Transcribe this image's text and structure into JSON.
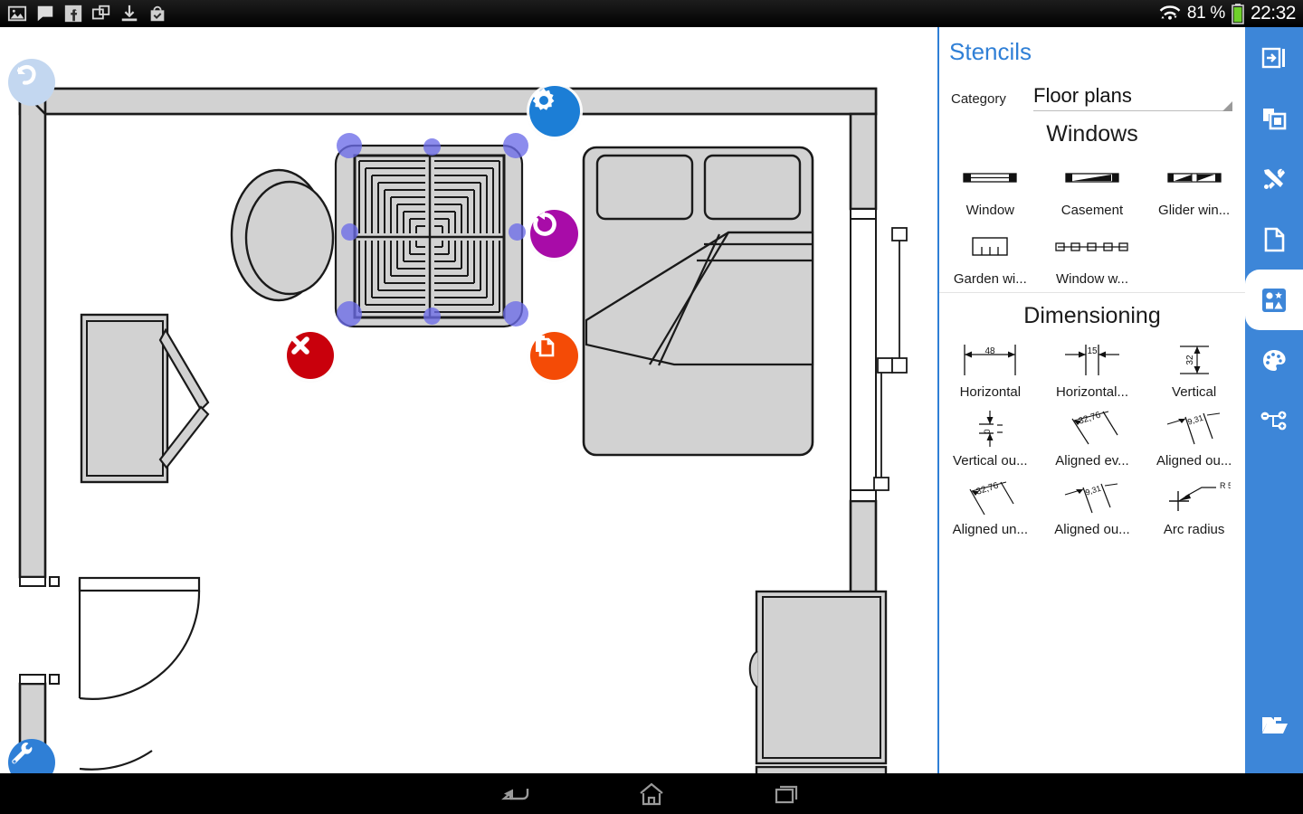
{
  "statusbar": {
    "notification_icons": [
      "image-icon",
      "message-icon",
      "facebook-icon",
      "screenshot-icon",
      "download-icon",
      "shopping-bag-check-icon"
    ],
    "wifi_icon": "wifi-icon",
    "battery_percent": "81 %",
    "battery_icon": "battery-icon",
    "clock": "22:32"
  },
  "canvas": {
    "name": "floor-plan-canvas",
    "undo_icon": "undo-icon",
    "tools_icon": "wrench-icon",
    "selection": {
      "object": "parquet-tile-pattern",
      "settings_icon": "gear-icon",
      "rotate_icon": "rotate-icon",
      "delete_icon": "delete-x-icon",
      "duplicate_icon": "copy-icon"
    },
    "objects": [
      "room-walls",
      "armchair",
      "desk-with-arms",
      "double-bed",
      "sliding-window-right-wall",
      "door-with-swing-arc",
      "wardrobe-cabinet",
      "parquet-rug"
    ]
  },
  "stencils": {
    "title": "Stencils",
    "category_label": "Category",
    "category_value": "Floor plans",
    "category_options": [
      "Floor plans"
    ],
    "groups": [
      {
        "title": "Windows",
        "items": [
          {
            "caption": "Window",
            "icon": "window-stencil-icon"
          },
          {
            "caption": "Casement",
            "icon": "casement-window-stencil-icon"
          },
          {
            "caption": "Glider win...",
            "icon": "glider-window-stencil-icon"
          },
          {
            "caption": "Garden wi...",
            "icon": "garden-window-stencil-icon"
          },
          {
            "caption": "Window w...",
            "icon": "window-wall-stencil-icon"
          }
        ]
      },
      {
        "title": "Dimensioning",
        "items": [
          {
            "caption": "Horizontal",
            "icon": "horizontal-dimension-icon",
            "value": "48"
          },
          {
            "caption": "Horizontal...",
            "icon": "horizontal-outside-dimension-icon",
            "value": "15"
          },
          {
            "caption": "Vertical",
            "icon": "vertical-dimension-icon",
            "value": "32"
          },
          {
            "caption": "Vertical ou...",
            "icon": "vertical-outside-dimension-icon",
            "value": "0"
          },
          {
            "caption": "Aligned ev...",
            "icon": "aligned-even-dimension-icon",
            "value": "32,76"
          },
          {
            "caption": "Aligned ou...",
            "icon": "aligned-outside-dimension-icon",
            "value": "9,31"
          },
          {
            "caption": "Aligned un...",
            "icon": "aligned-under-dimension-icon",
            "value": "32,76"
          },
          {
            "caption": "Aligned ou...",
            "icon": "aligned-outside2-dimension-icon",
            "value": "9,31"
          },
          {
            "caption": "Arc radius",
            "icon": "arc-radius-dimension-icon",
            "value": "R 5"
          }
        ]
      }
    ]
  },
  "rail": {
    "accent": "#3d86d8",
    "buttons": [
      {
        "name": "import-icon",
        "active": false
      },
      {
        "name": "layers-icon",
        "active": false
      },
      {
        "name": "tools-icon",
        "active": false
      },
      {
        "name": "page-icon",
        "active": false
      },
      {
        "name": "stencils-icon",
        "active": true
      },
      {
        "name": "palette-icon",
        "active": false
      },
      {
        "name": "connectors-icon",
        "active": false
      }
    ],
    "folder_button": {
      "name": "folder-icon",
      "active": false
    }
  },
  "navbar": {
    "back_icon": "back-icon",
    "home_icon": "home-icon",
    "recents_icon": "recents-icon"
  },
  "colors": {
    "accent_blue": "#2f7fd6",
    "rail_blue": "#3d86d8",
    "rotate_purple": "#a80ca8",
    "delete_red": "#c9000c",
    "copy_orange": "#f44b06",
    "handle_violet": "#6b6be8",
    "wall_fill": "#d2d2d2"
  }
}
